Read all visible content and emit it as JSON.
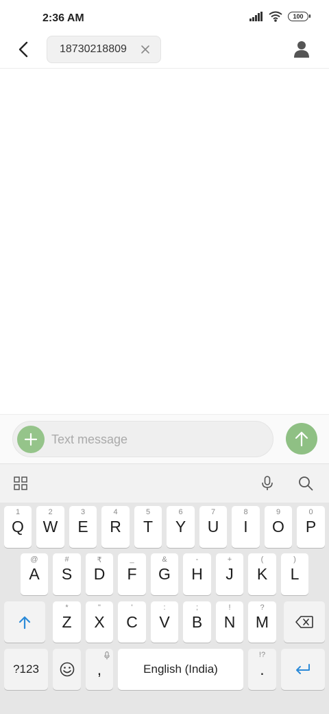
{
  "status_bar": {
    "time": "2:36 AM",
    "battery": "100"
  },
  "header": {
    "recipient": "18730218809"
  },
  "compose": {
    "placeholder": "Text message"
  },
  "keyboard": {
    "row1": [
      {
        "letter": "Q",
        "hint": "1"
      },
      {
        "letter": "W",
        "hint": "2"
      },
      {
        "letter": "E",
        "hint": "3"
      },
      {
        "letter": "R",
        "hint": "4"
      },
      {
        "letter": "T",
        "hint": "5"
      },
      {
        "letter": "Y",
        "hint": "6"
      },
      {
        "letter": "U",
        "hint": "7"
      },
      {
        "letter": "I",
        "hint": "8"
      },
      {
        "letter": "O",
        "hint": "9"
      },
      {
        "letter": "P",
        "hint": "0"
      }
    ],
    "row2": [
      {
        "letter": "A",
        "hint": "@"
      },
      {
        "letter": "S",
        "hint": "#"
      },
      {
        "letter": "D",
        "hint": "₹"
      },
      {
        "letter": "F",
        "hint": "_"
      },
      {
        "letter": "G",
        "hint": "&"
      },
      {
        "letter": "H",
        "hint": "-"
      },
      {
        "letter": "J",
        "hint": "+"
      },
      {
        "letter": "K",
        "hint": "("
      },
      {
        "letter": "L",
        "hint": ")"
      }
    ],
    "row3": [
      {
        "letter": "Z",
        "hint": "*"
      },
      {
        "letter": "X",
        "hint": "\""
      },
      {
        "letter": "C",
        "hint": "'"
      },
      {
        "letter": "V",
        "hint": ":"
      },
      {
        "letter": "B",
        "hint": ";"
      },
      {
        "letter": "N",
        "hint": "!"
      },
      {
        "letter": "M",
        "hint": "?"
      }
    ],
    "symbols_label": "?123",
    "comma_label": ",",
    "space_label": "English (India)",
    "period_label": ".",
    "period_hint": "!?"
  },
  "colors": {
    "accent_green": "#8fc084",
    "keyboard_blue": "#2b8ad8"
  },
  "icons": [
    "back-arrow-icon",
    "close-icon",
    "contact-icon",
    "plus-icon",
    "send-arrow-icon",
    "apps-grid-icon",
    "microphone-icon",
    "search-icon",
    "shift-icon",
    "backspace-icon",
    "emoji-icon",
    "enter-icon"
  ]
}
